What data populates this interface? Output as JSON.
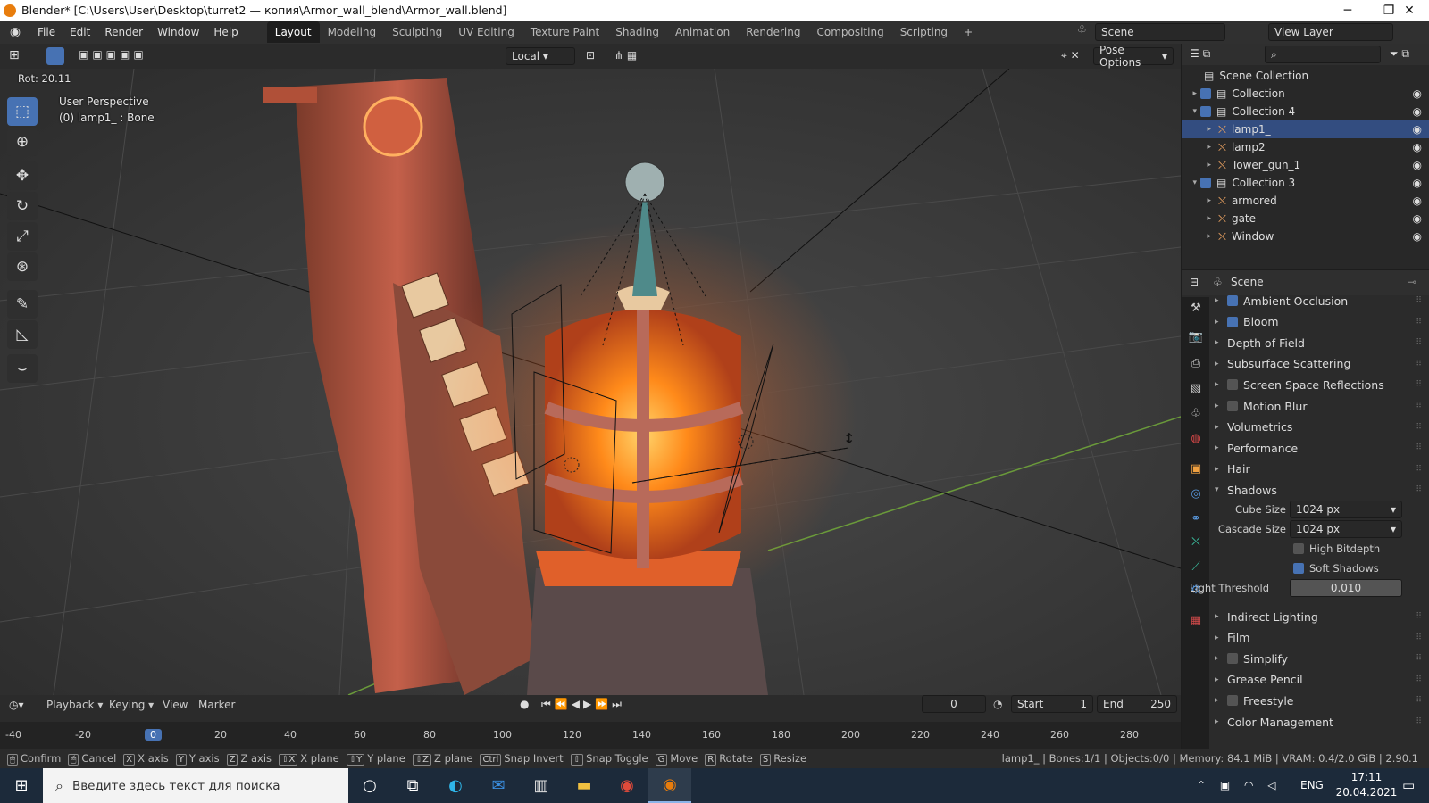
{
  "window": {
    "title": "Blender* [C:\\Users\\User\\Desktop\\turret2 — копия\\Armor_wall_blend\\Armor_wall.blend]"
  },
  "menu": [
    "File",
    "Edit",
    "Render",
    "Window",
    "Help"
  ],
  "workspaces": [
    "Layout",
    "Modeling",
    "Sculpting",
    "UV Editing",
    "Texture Paint",
    "Shading",
    "Animation",
    "Rendering",
    "Compositing",
    "Scripting"
  ],
  "scene_name": "Scene",
  "view_layer": "View Layer",
  "header": {
    "transform_orientation": "Local",
    "pose_options": "Pose Options"
  },
  "viewport": {
    "op_info": "Rot: 20.11",
    "perspective": "User Perspective",
    "object_info": "(0) lamp1_ : Bone"
  },
  "outliner": {
    "root": "Scene Collection",
    "rows": [
      {
        "label": "Collection",
        "indent": 0
      },
      {
        "label": "Collection 4",
        "indent": 0
      },
      {
        "label": "lamp1_",
        "indent": 1,
        "selected": true
      },
      {
        "label": "lamp2_",
        "indent": 1
      },
      {
        "label": "Tower_gun_1",
        "indent": 1
      },
      {
        "label": "Collection 3",
        "indent": 0
      },
      {
        "label": "armored",
        "indent": 1
      },
      {
        "label": "gate",
        "indent": 1
      },
      {
        "label": "Window",
        "indent": 1
      }
    ]
  },
  "properties": {
    "context": "Scene",
    "panels": [
      {
        "label": "Ambient Occlusion",
        "checkbox": true,
        "checked": true
      },
      {
        "label": "Bloom",
        "checkbox": true,
        "checked": true
      },
      {
        "label": "Depth of Field"
      },
      {
        "label": "Subsurface Scattering"
      },
      {
        "label": "Screen Space Reflections",
        "checkbox": true,
        "checked": false
      },
      {
        "label": "Motion Blur",
        "checkbox": true,
        "checked": false
      },
      {
        "label": "Volumetrics"
      },
      {
        "label": "Performance"
      },
      {
        "label": "Hair"
      },
      {
        "label": "Shadows",
        "expanded": true
      }
    ],
    "shadows": {
      "cube_size_label": "Cube Size",
      "cube_size": "1024 px",
      "cascade_size_label": "Cascade Size",
      "cascade_size": "1024 px",
      "high_bitdepth_label": "High Bitdepth",
      "high_bitdepth": false,
      "soft_shadows_label": "Soft Shadows",
      "soft_shadows": true,
      "light_threshold_label": "Light Threshold",
      "light_threshold": "0.010"
    },
    "panels_after": [
      {
        "label": "Indirect Lighting"
      },
      {
        "label": "Film"
      },
      {
        "label": "Simplify",
        "checkbox": true,
        "checked": false
      },
      {
        "label": "Grease Pencil"
      },
      {
        "label": "Freestyle",
        "checkbox": true,
        "checked": false
      },
      {
        "label": "Color Management"
      }
    ]
  },
  "timeline": {
    "menus": [
      "Playback",
      "Keying",
      "View",
      "Marker"
    ],
    "current_frame": "0",
    "start_label": "Start",
    "start": "1",
    "end_label": "End",
    "end": "250",
    "ruler": [
      "-40",
      "-20",
      "0",
      "20",
      "40",
      "60",
      "80",
      "100",
      "120",
      "140",
      "160",
      "180",
      "200",
      "220",
      "240",
      "260",
      "280"
    ]
  },
  "statusbar": {
    "items": [
      {
        "key": "",
        "label": "Confirm"
      },
      {
        "key": "",
        "label": "Cancel"
      },
      {
        "key": "X",
        "label": "X axis"
      },
      {
        "key": "Y",
        "label": "Y axis"
      },
      {
        "key": "Z",
        "label": "Z axis"
      },
      {
        "key": "⇧X",
        "label": "X plane"
      },
      {
        "key": "⇧Y",
        "label": "Y plane"
      },
      {
        "key": "⇧Z",
        "label": "Z plane"
      },
      {
        "key": "Ctrl",
        "label": "Snap Invert"
      },
      {
        "key": "⇧",
        "label": "Snap Toggle"
      },
      {
        "key": "G",
        "label": "Move"
      },
      {
        "key": "R",
        "label": "Rotate"
      },
      {
        "key": "S",
        "label": "Resize"
      }
    ],
    "info": "lamp1_ | Bones:1/1 | Objects:0/0 | Memory: 84.1 MiB | VRAM: 0.4/2.0 GiB | 2.90.1"
  },
  "taskbar": {
    "search_placeholder": "Введите здесь текст для поиска",
    "lang": "ENG",
    "time": "17:11",
    "date": "20.04.2021"
  },
  "colors": {
    "accent": "#4772b3",
    "selected_row": "#334d80",
    "glow": "#ff8a1a"
  }
}
